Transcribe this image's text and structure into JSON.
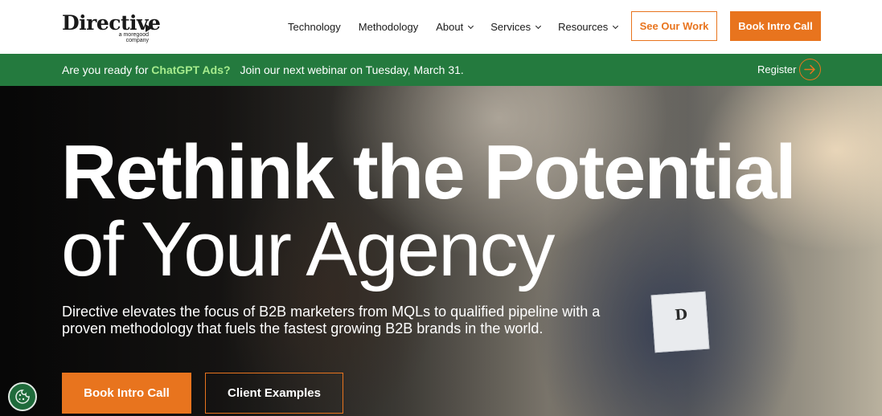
{
  "header": {
    "logo": {
      "word": "Directive",
      "sub": "a moregood company"
    },
    "nav": [
      {
        "label": "Technology",
        "dropdown": false
      },
      {
        "label": "Methodology",
        "dropdown": false
      },
      {
        "label": "About",
        "dropdown": true
      },
      {
        "label": "Services",
        "dropdown": true
      },
      {
        "label": "Resources",
        "dropdown": true
      }
    ],
    "see_work_label": "See Our Work",
    "book_call_label": "Book Intro Call"
  },
  "announcement": {
    "prefix": "Are you ready for",
    "highlight": "ChatGPT Ads?",
    "message": "Join our next webinar on Tuesday, March 31.",
    "register_label": "Register"
  },
  "hero": {
    "title_line1": "Rethink the Potential",
    "title_line2": "of Your Agency",
    "subtitle": "Directive elevates the focus of B2B marketers from MQLs to qualified pipeline with a proven methodology that fuels the fastest growing B2B brands in the world.",
    "primary_cta": "Book Intro Call",
    "secondary_cta": "Client Examples"
  },
  "icons": {
    "register_arrow": "arrow-right-icon",
    "cookie": "cookie-icon",
    "nav_dropdown": "chevron-down-icon"
  },
  "colors": {
    "accent": "#e8741e",
    "banner_green": "#247a3e",
    "highlight_green": "#a6eb8c",
    "text_dark": "#1a1a1a"
  }
}
